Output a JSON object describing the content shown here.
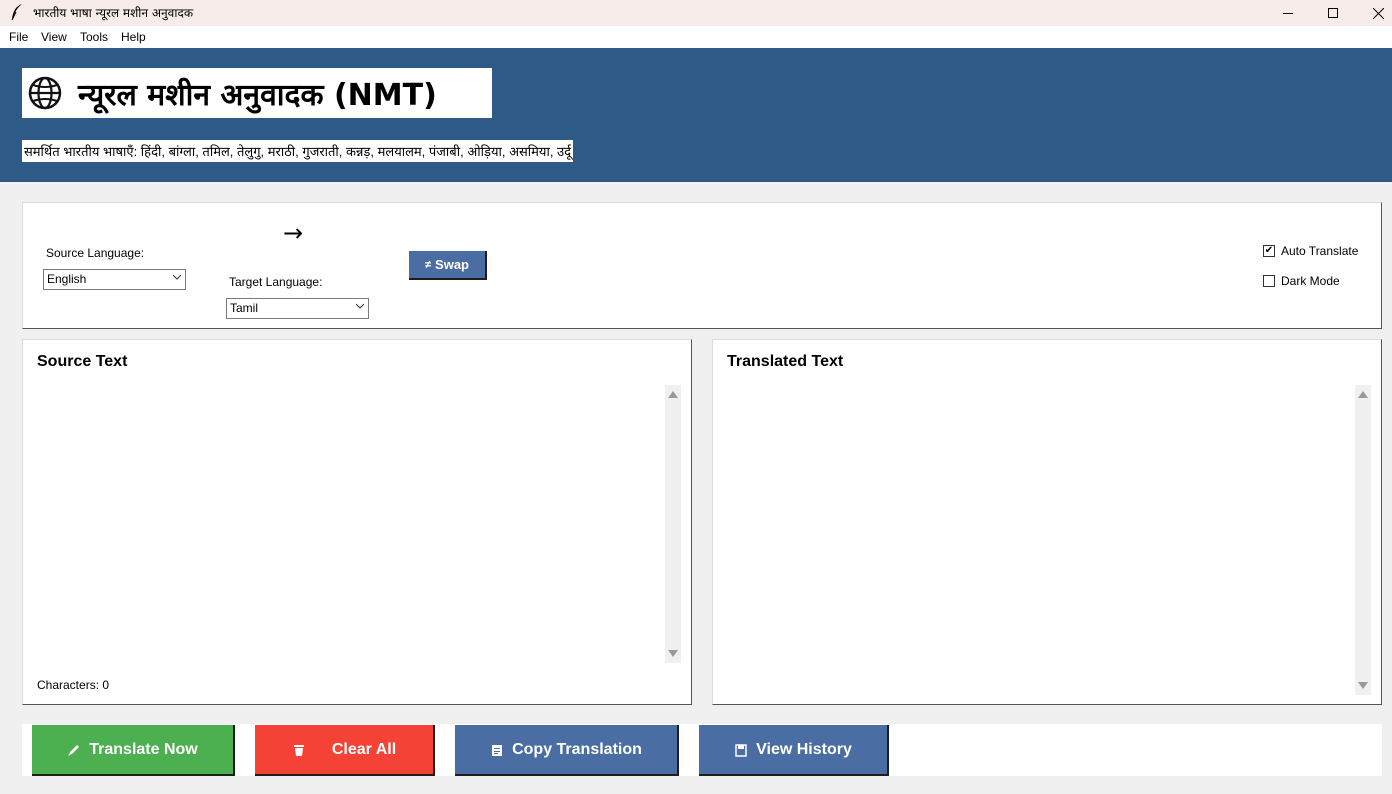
{
  "window": {
    "title": "भारतीय भाषा न्यूरल मशीन अनुवादक",
    "icon": "feather-icon"
  },
  "menu": [
    "File",
    "View",
    "Tools",
    "Help"
  ],
  "header": {
    "title": "न्यूरल मशीन अनुवादक (NMT)",
    "icon": "globe-icon",
    "languages_line": "समर्थित भारतीय भाषाएँ: हिंदी, बांग्ला, तमिल, तेलुगु, मराठी, गुजराती, कन्नड़, मलयालम, पंजाबी, ओड़िया, असमिया, उर्दू",
    "background": "#2e5a87"
  },
  "controls": {
    "source_label": "Source Language:",
    "source_value": "English",
    "arrow": "→",
    "target_label": "Target Language:",
    "target_value": "Tamil",
    "swap_label": "Swap",
    "swap_icon": "≠",
    "auto_translate_label": "Auto Translate",
    "auto_translate_checked": true,
    "dark_mode_label": "Dark Mode",
    "dark_mode_checked": false
  },
  "source_panel": {
    "title": "Source Text",
    "text": "",
    "char_count": "Characters: 0"
  },
  "target_panel": {
    "title": "Translated Text",
    "text": ""
  },
  "actions": {
    "translate": "Translate Now",
    "clear": "Clear All",
    "copy": "Copy Translation",
    "history": "View History"
  },
  "colors": {
    "green": "#4caf50",
    "red": "#f44336",
    "blue": "#4a6da3"
  }
}
